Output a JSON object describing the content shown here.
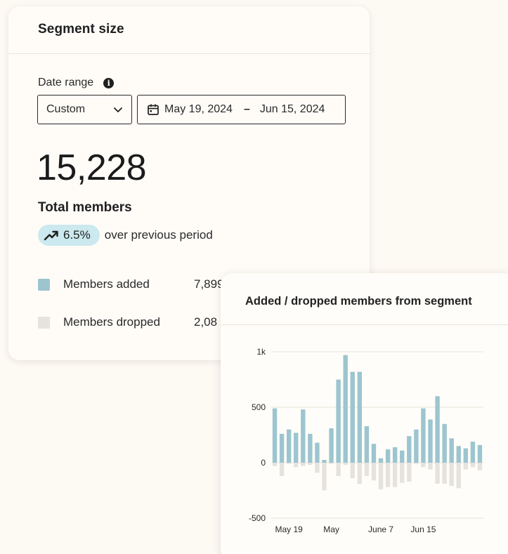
{
  "segment_card": {
    "title": "Segment size",
    "date_range_label": "Date range",
    "info_icon": "info-icon",
    "select_value": "Custom",
    "date_start": "May 19, 2024",
    "date_separator": "–",
    "date_end": "Jun 15, 2024",
    "total_value": "15,228",
    "total_label": "Total members",
    "trend_percent": "6.5%",
    "trend_text": "over previous period",
    "legend": [
      {
        "label": "Members added",
        "value": "7,899",
        "color": "#9cc5cf"
      },
      {
        "label": "Members dropped",
        "value": "2,08",
        "color": "#e6e3df"
      }
    ]
  },
  "chart_card": {
    "title": "Added / dropped members from segment"
  },
  "colors": {
    "added": "#9cc5cf",
    "dropped": "#e6e3df",
    "badge": "#cbe9ee",
    "background": "#fdf9f3"
  },
  "chart_data": {
    "type": "bar",
    "title": "Added / dropped members from segment",
    "ylim": [
      -500,
      1000
    ],
    "y_ticks": [
      "1k",
      "500",
      "0",
      "-500"
    ],
    "x_tick_labels": [
      "May 19",
      "May",
      "June 7",
      "Jun 15"
    ],
    "grid": true,
    "series": [
      {
        "name": "Members added",
        "values": [
          490,
          260,
          300,
          270,
          480,
          260,
          180,
          25,
          310,
          750,
          970,
          820,
          820,
          330,
          170,
          40,
          120,
          140,
          110,
          240,
          300,
          490,
          390,
          600,
          350,
          220,
          150,
          130,
          190,
          160
        ]
      },
      {
        "name": "Members dropped",
        "values": [
          -30,
          -120,
          -10,
          -40,
          -30,
          -20,
          -90,
          -250,
          -10,
          -120,
          -20,
          -140,
          -190,
          -120,
          -160,
          -240,
          -220,
          -220,
          -180,
          -170,
          -10,
          -40,
          -60,
          -190,
          -190,
          -210,
          -230,
          -60,
          -40,
          -70
        ]
      }
    ]
  }
}
